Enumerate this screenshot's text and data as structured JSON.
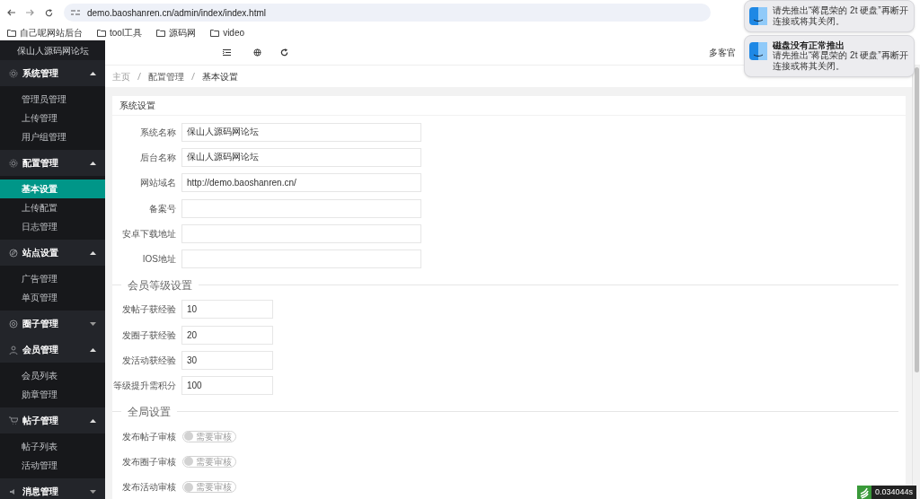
{
  "browser": {
    "url": "demo.baoshanren.cn/admin/index/index.html",
    "bookmarks": [
      "自己呢网站后台",
      "tool工具",
      "源码网",
      "video"
    ]
  },
  "sidebar": {
    "title": "保山人源码网论坛",
    "groups": [
      {
        "label": "系统管理",
        "expanded": true,
        "children": [
          {
            "label": "管理员管理",
            "selected": false
          },
          {
            "label": "上传管理",
            "selected": false
          },
          {
            "label": "用户组管理",
            "selected": false
          }
        ]
      },
      {
        "label": "配置管理",
        "expanded": true,
        "children": [
          {
            "label": "基本设置",
            "selected": true
          },
          {
            "label": "上传配置",
            "selected": false
          },
          {
            "label": "日志管理",
            "selected": false
          }
        ]
      },
      {
        "label": "站点设置",
        "expanded": true,
        "children": [
          {
            "label": "广告管理",
            "selected": false
          },
          {
            "label": "单页管理",
            "selected": false
          }
        ]
      },
      {
        "label": "圈子管理",
        "expanded": false
      },
      {
        "label": "会员管理",
        "expanded": true,
        "children": [
          {
            "label": "会员列表",
            "selected": false
          },
          {
            "label": "勋章管理",
            "selected": false
          }
        ]
      },
      {
        "label": "帖子管理",
        "expanded": true,
        "children": [
          {
            "label": "帖子列表",
            "selected": false
          },
          {
            "label": "活动管理",
            "selected": false
          }
        ]
      },
      {
        "label": "消息管理",
        "expanded": false
      }
    ]
  },
  "header": {
    "user": "多客官"
  },
  "breadcrumb": [
    "主页",
    "配置管理",
    "基本设置"
  ],
  "card": {
    "title": "系统设置",
    "sections": [
      {
        "fields": [
          {
            "kind": "text",
            "label": "系统名称",
            "value": "保山人源码网论坛"
          },
          {
            "kind": "text",
            "label": "后台名称",
            "value": "保山人源码网论坛"
          },
          {
            "kind": "text",
            "label": "网站域名",
            "value": "http://demo.baoshanren.cn/"
          },
          {
            "kind": "text",
            "label": "备案号"
          },
          {
            "kind": "text",
            "label": "安卓下载地址"
          },
          {
            "kind": "text",
            "label": "IOS地址"
          }
        ]
      },
      {
        "title": "会员等级设置",
        "fields": [
          {
            "kind": "number",
            "label": "发帖子获经验",
            "value": "10"
          },
          {
            "kind": "number",
            "label": "发圈子获经验",
            "value": "20"
          },
          {
            "kind": "number",
            "label": "发活动获经验",
            "value": "30"
          },
          {
            "kind": "number",
            "label": "等级提升需积分",
            "value": "100"
          }
        ]
      },
      {
        "title": "全局设置",
        "fields": [
          {
            "kind": "switch",
            "label": "发布帖子审核",
            "text": "需要审核",
            "checked": false
          },
          {
            "kind": "switch",
            "label": "发布圈子审核",
            "text": "需要审核",
            "checked": false
          },
          {
            "kind": "switch",
            "label": "发布活动审核",
            "text": "需要审核",
            "checked": false
          }
        ]
      }
    ]
  },
  "notifications": [
    {
      "body": "请先推出“蒋昆荣的 2t 硬盘”再断开连接或将其关闭。"
    },
    {
      "title": "磁盘没有正常推出",
      "body": "请先推出“蒋昆荣的 2t 硬盘”再断开连接或将其关闭。"
    }
  ],
  "debug": {
    "time": "0.034044s"
  }
}
